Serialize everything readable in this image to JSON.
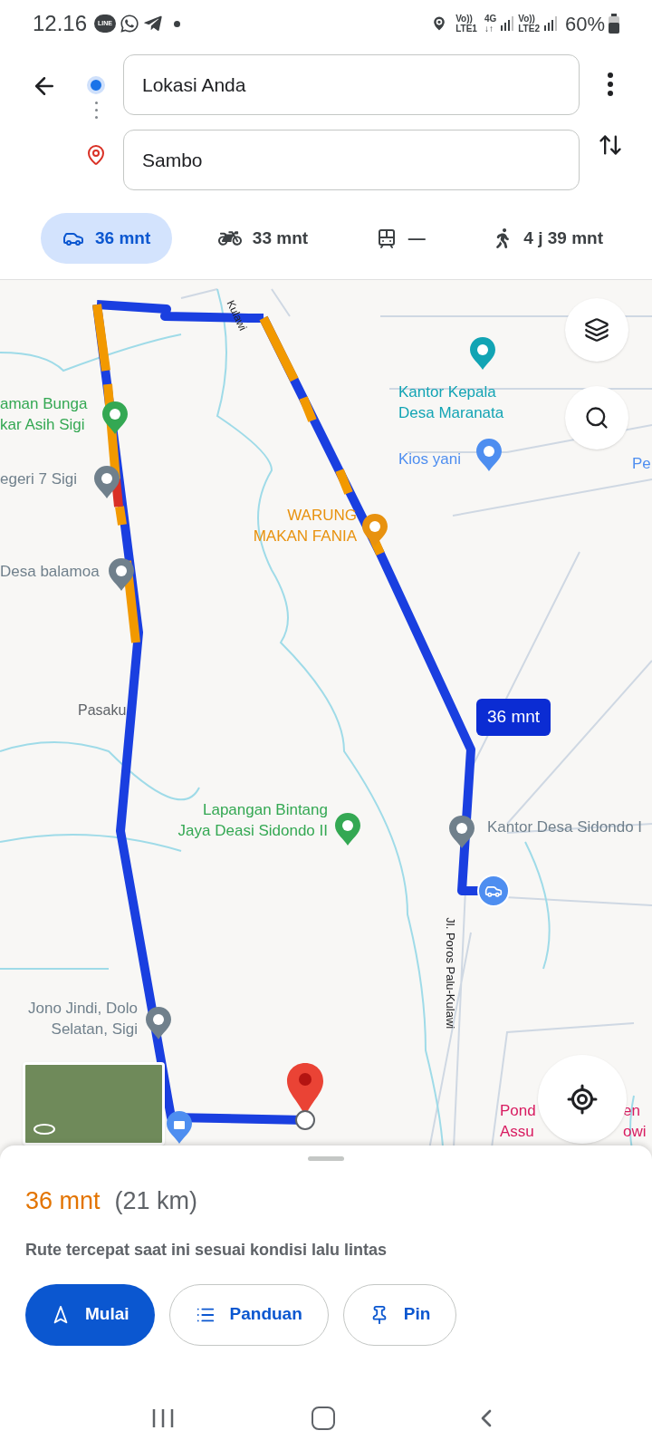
{
  "status_bar": {
    "time": "12.16",
    "line_logo": "LINE",
    "sims": [
      {
        "top": "Vo))",
        "bottom": "LTE1"
      },
      {
        "top": "4G",
        "bottom": "↓↑"
      },
      {
        "top": "Vo))",
        "bottom": "LTE2"
      }
    ],
    "battery": "60%"
  },
  "directions": {
    "origin": "Lokasi Anda",
    "destination": "Sambo"
  },
  "modes": [
    {
      "kind": "car",
      "label": "36 mnt",
      "selected": true
    },
    {
      "kind": "motorbike",
      "label": "33 mnt",
      "selected": false
    },
    {
      "kind": "transit",
      "label": "—",
      "selected": false
    },
    {
      "kind": "walk",
      "label": "4 j 39 mnt",
      "selected": false
    }
  ],
  "map": {
    "places": [
      {
        "label": "aman Bunga\nkar Asih Sigi",
        "color": "#34a853"
      },
      {
        "label": "egeri 7 Sigi",
        "color": "#70808c"
      },
      {
        "label": "Desa balamoa",
        "color": "#70808c"
      },
      {
        "label": "Kantor Kepala\nDesa Maranata",
        "color": "#12a4b4"
      },
      {
        "label": "Kios yani",
        "color": "#4e8ef0"
      },
      {
        "label": "WARUNG\nMAKAN FANIA",
        "color": "#e8920f"
      },
      {
        "label": "Lapangan Bintang\nJaya Deasi Sidondo II",
        "color": "#34a853"
      },
      {
        "label": "Kantor Desa Sidondo I",
        "color": "#70808c"
      },
      {
        "label": "Jono Jindi, Dolo\nSelatan, Sigi",
        "color": "#70808c"
      }
    ],
    "area_labels": [
      "Pasaku",
      "Pe",
      "Pond\nAssu",
      "en\nowi"
    ],
    "road_labels": [
      "Kulawi",
      "Jl. Poros Palu-Kulawi"
    ],
    "route_time": "36 mnt"
  },
  "summary": {
    "duration": "36 mnt",
    "distance": "(21 km)",
    "note": "Rute tercepat saat ini sesuai kondisi lalu lintas"
  },
  "actions": [
    {
      "kind": "start",
      "label": "Mulai"
    },
    {
      "kind": "steps",
      "label": "Panduan"
    },
    {
      "kind": "pin",
      "label": "Pin"
    }
  ]
}
